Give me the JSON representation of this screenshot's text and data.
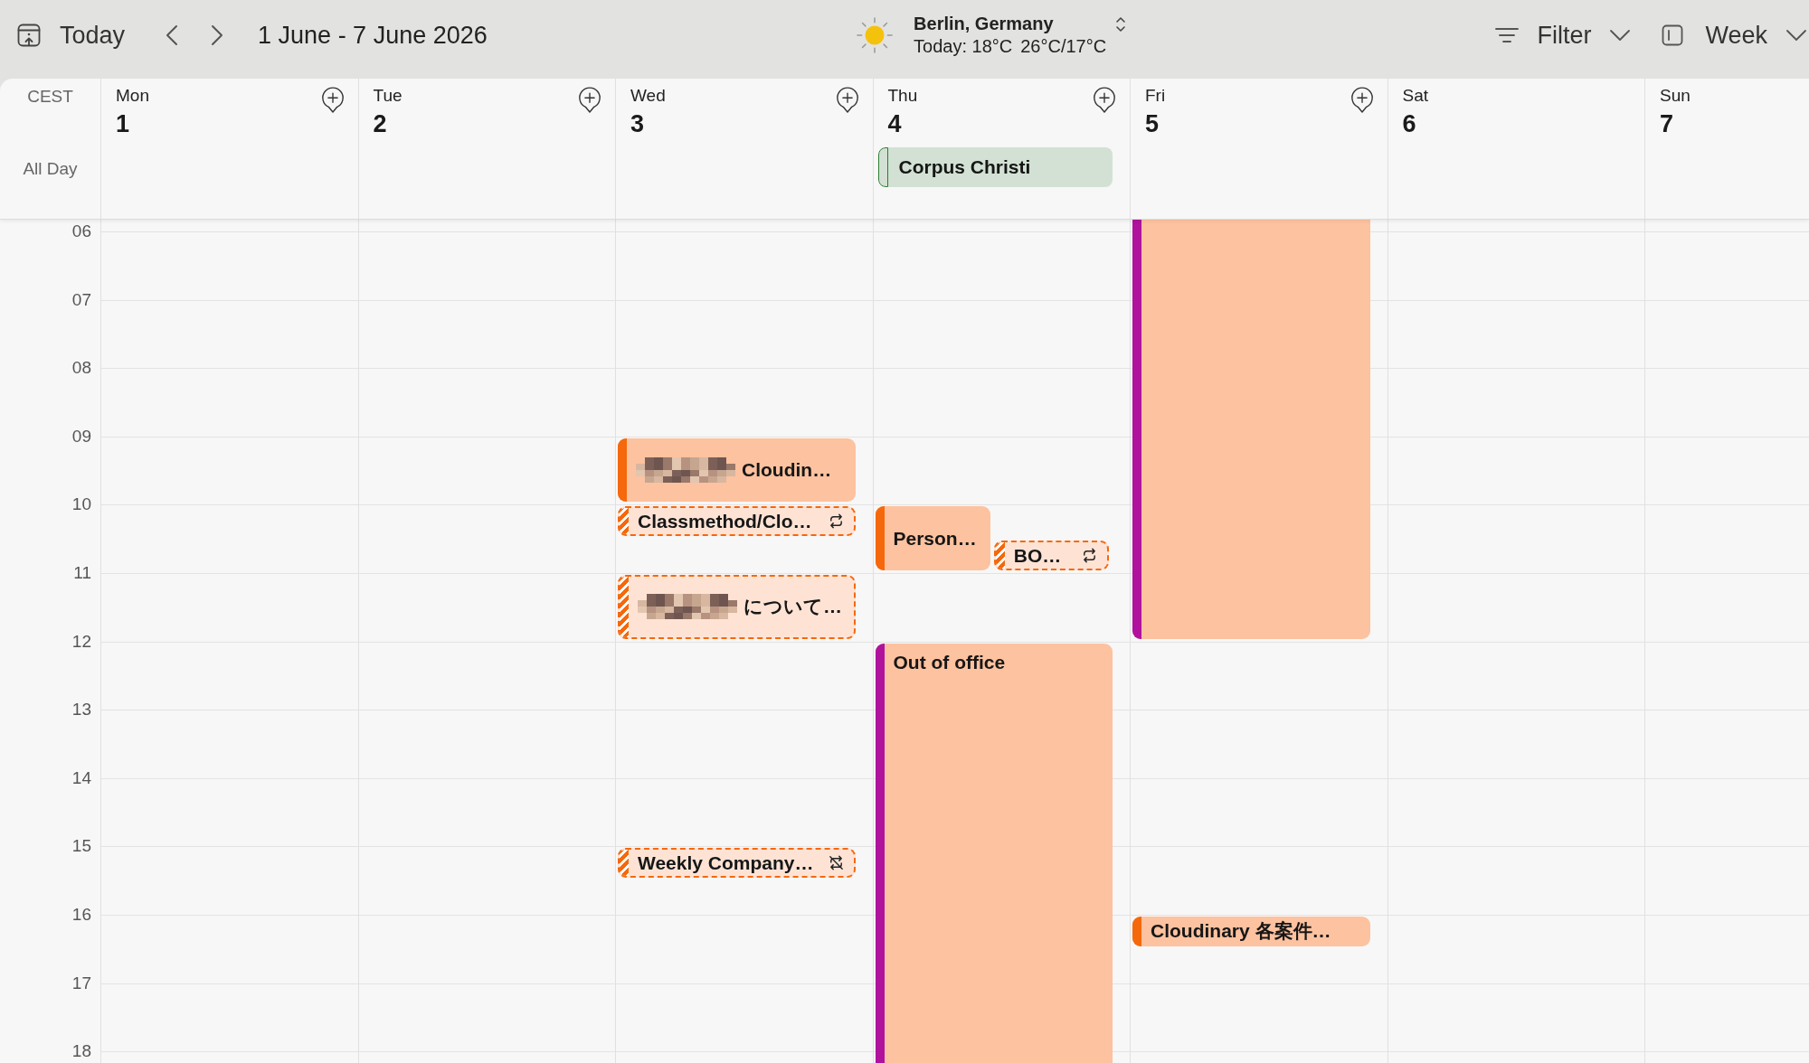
{
  "toolbar": {
    "today": "Today",
    "date_range": "1 June - 7 June 2026",
    "weather": {
      "location": "Berlin, Germany",
      "current": "Today: 18°C",
      "high_low": "26°C/17°C"
    },
    "filter": "Filter",
    "view": "Week"
  },
  "calendar": {
    "timezone": "CEST",
    "all_day_label": "All Day",
    "hours": [
      "06",
      "07",
      "08",
      "09",
      "10",
      "11",
      "12",
      "13",
      "14",
      "15",
      "16",
      "17",
      "18"
    ],
    "days": [
      {
        "weekday": "Mon",
        "date": "1",
        "add_button": true
      },
      {
        "weekday": "Tue",
        "date": "2",
        "add_button": true
      },
      {
        "weekday": "Wed",
        "date": "3",
        "add_button": true,
        "events": [
          {
            "kind": "confirmed",
            "title": "Cloudin…",
            "redacted": true,
            "color": "#f5680c"
          },
          {
            "kind": "tentative",
            "title": "Classmethod/Clo…",
            "redacted": false,
            "recurrence": {
              "kind": "series"
            },
            "color": "#f5680c"
          },
          {
            "kind": "tentative",
            "title": "について…",
            "redacted": true,
            "color": "#f5680c"
          },
          {
            "kind": "tentative",
            "title": "Weekly Company…",
            "redacted": false,
            "recurrence": {
              "kind": "detached"
            },
            "color": "#f5680c"
          }
        ]
      },
      {
        "weekday": "Thu",
        "date": "4",
        "add_button": true,
        "all_day_events": [
          {
            "title": "Corpus Christi",
            "color": "#2e7d32"
          }
        ],
        "events": [
          {
            "kind": "confirmed",
            "title": "Person…",
            "redacted": false,
            "color": "#f5680c"
          },
          {
            "kind": "tentative",
            "title": "BO…",
            "redacted": false,
            "recurrence": {
              "kind": "series"
            },
            "color": "#f5680c"
          },
          {
            "kind": "confirmed",
            "title": "Out of office",
            "redacted": false,
            "color": "#b0129e"
          }
        ]
      },
      {
        "weekday": "Fri",
        "date": "5",
        "add_button": true,
        "events": [
          {
            "kind": "confirmed",
            "redacted": false,
            "color": "#b0129e"
          },
          {
            "kind": "confirmed",
            "title": "Cloudinary 各案件…",
            "redacted": false,
            "color": "#f5680c"
          }
        ]
      },
      {
        "weekday": "Sat",
        "date": "6",
        "add_button": false
      },
      {
        "weekday": "Sun",
        "date": "7",
        "add_button": false
      }
    ]
  }
}
